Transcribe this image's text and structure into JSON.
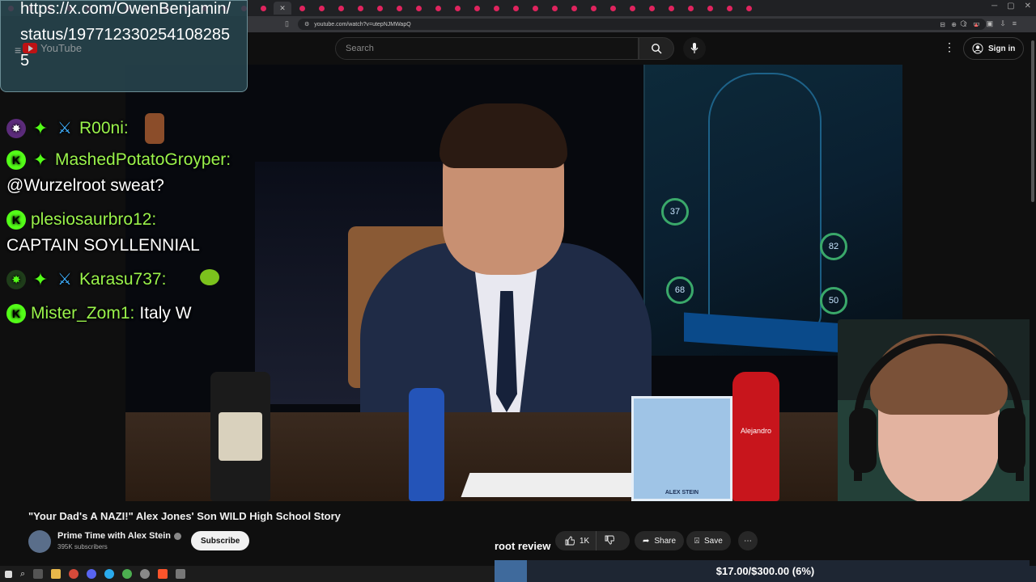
{
  "browser": {
    "url": "youtube.com/watch?v=utepNJMWapQ",
    "tab_count": 39
  },
  "youtube": {
    "search_placeholder": "Search",
    "signin_label": "Sign in",
    "logo_text": "YouTube"
  },
  "overlay": {
    "url_text": "https://x.com/OwenBenjamin/status/1977123302541082855"
  },
  "chat": [
    {
      "user": "R00ni:",
      "text": "",
      "badges": [
        "purple-dot-badge",
        "green-diamond-badge",
        "sword-badge"
      ],
      "emote": "bear-emote"
    },
    {
      "user": "MashedPotatoGroyper:",
      "text": "@Wurzelroot sweat?",
      "badges": [
        "kick-badge",
        "green-diamond-badge"
      ]
    },
    {
      "user": "plesiosaurbro12:",
      "text": "CAPTAIN SOYLLENNIAL",
      "badges": [
        "kick-badge"
      ]
    },
    {
      "user": "Karasu737:",
      "text": "",
      "badges": [
        "green-dot-badge",
        "green-diamond-badge",
        "sword-badge"
      ],
      "emote": "bug-emote"
    },
    {
      "user": "Mister_Zom1:",
      "text": "Italy W",
      "badges": [
        "kick-badge"
      ]
    }
  ],
  "video": {
    "title": "\"Your Dad's A NAZI!\" Alex Jones' Son WILD High School Story",
    "channel": "Prime Time with Alex Stein",
    "subscribers": "395K subscribers",
    "subscribe_label": "Subscribe",
    "likes": "1K",
    "share_label": "Share",
    "save_label": "Save",
    "overlay_caption": "root review",
    "gauge_values": [
      "37",
      "82",
      "68",
      "50"
    ],
    "bottle_label": "Alejandro",
    "funko_label": "ALEX STEIN"
  },
  "donation": {
    "text": "$17.00/$300.00 (6%)",
    "progress": 0.06
  },
  "colors": {
    "accent_green": "#53fc18",
    "username_green": "#9af34b",
    "youtube_red": "#ff0000"
  }
}
